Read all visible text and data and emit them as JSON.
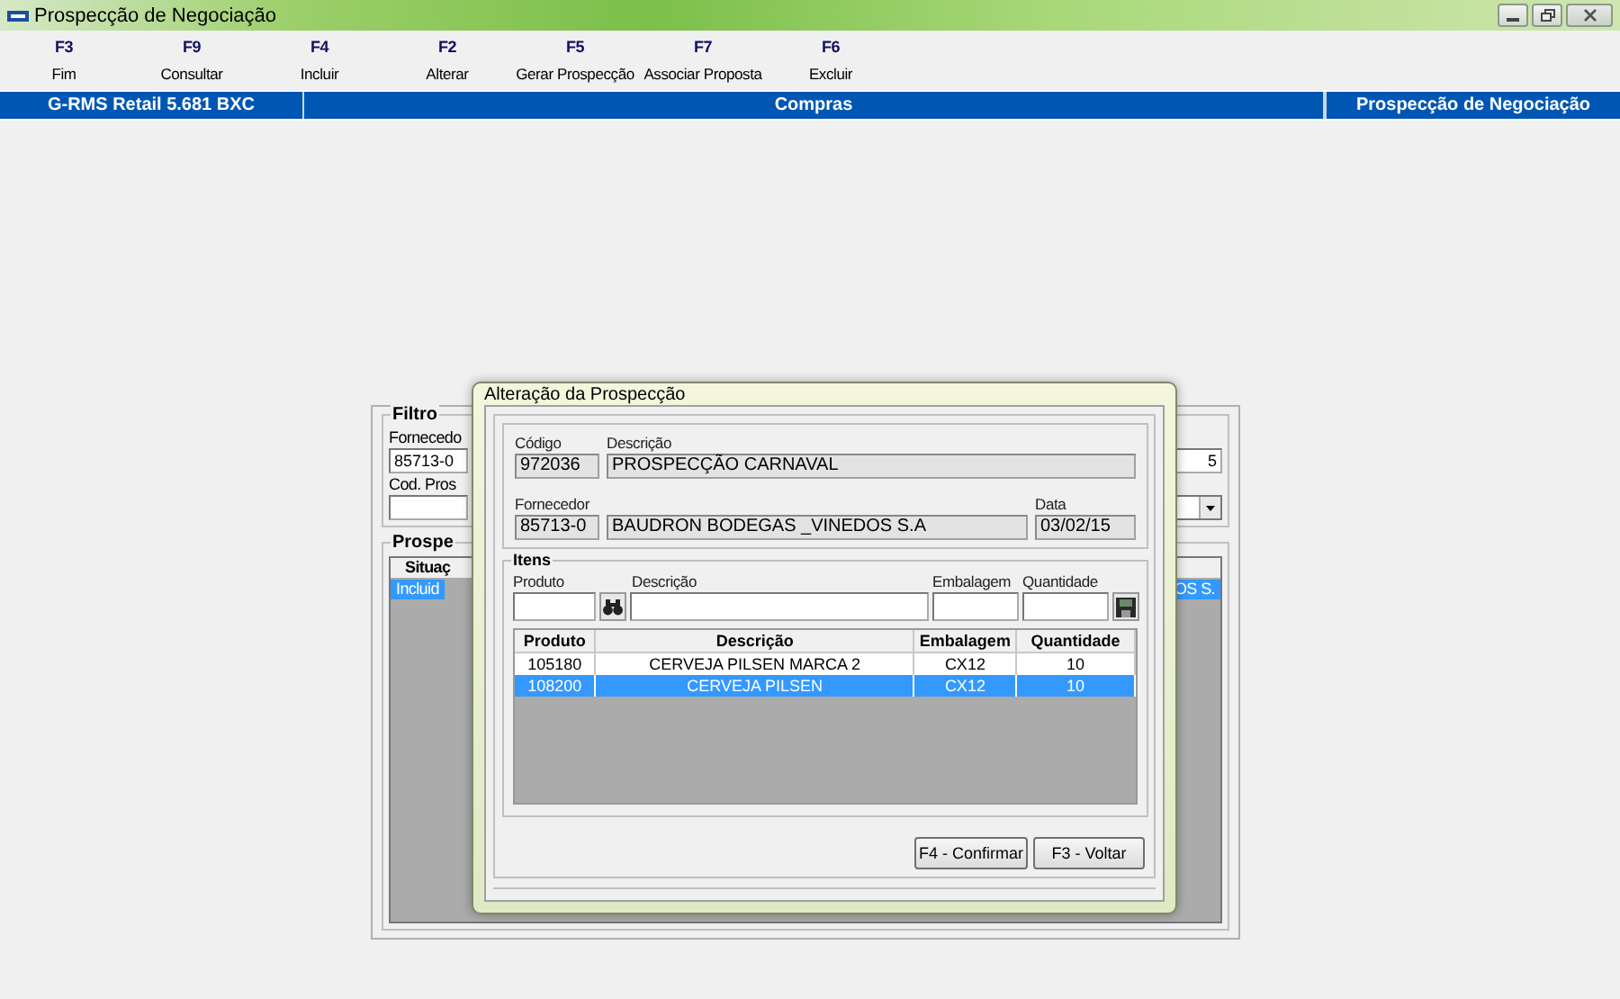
{
  "window": {
    "title": "Prospecção de Negociação"
  },
  "toolbar": [
    {
      "key": "F3",
      "label": "Fim"
    },
    {
      "key": "F9",
      "label": "Consultar"
    },
    {
      "key": "F4",
      "label": "Incluir"
    },
    {
      "key": "F2",
      "label": "Alterar"
    },
    {
      "key": "F5",
      "label": "Gerar Prospecção"
    },
    {
      "key": "F7",
      "label": "Associar Proposta"
    },
    {
      "key": "F6",
      "label": "Excluir"
    }
  ],
  "banner": {
    "version": "G-RMS Retail 5.681 BXC",
    "module": "Compras",
    "screen": "Prospecção de Negociação"
  },
  "background_form": {
    "filter_title": "Filtro",
    "supplier_label": "Fornecedo",
    "supplier_code": "85713-0",
    "supplier_name": "5",
    "code_label": "Cod. Pros",
    "list_title": "Prospe",
    "column_1": "Situaç",
    "row": {
      "status": "Incluid",
      "supplier": "OS S.",
      "selected": true
    }
  },
  "dialog": {
    "title": "Alteração da Prospecção",
    "code_label": "Código",
    "code": "972036",
    "description_label": "Descrição",
    "description": "PROSPECÇÃO CARNAVAL",
    "supplier_label": "Fornecedor",
    "supplier_code": "85713-0",
    "supplier_name": "BAUDRON BODEGAS _VINEDOS S.A",
    "date_label": "Data",
    "date": "03/02/15",
    "items": {
      "title": "Itens",
      "product_label": "Produto",
      "description_label": "Descrição",
      "package_label": "Embalagem",
      "quantity_label": "Quantidade",
      "table": {
        "columns": [
          "Produto",
          "Descrição",
          "Embalagem",
          "Quantidade"
        ],
        "rows": [
          {
            "cells": [
              "105180",
              "CERVEJA PILSEN MARCA 2",
              "CX12",
              "10"
            ],
            "selected": false
          },
          {
            "cells": [
              "108200",
              "CERVEJA PILSEN",
              "CX12",
              "10"
            ],
            "selected": true
          }
        ]
      }
    },
    "buttons": [
      "F4 - Confirmar",
      "F3 - Voltar"
    ]
  }
}
